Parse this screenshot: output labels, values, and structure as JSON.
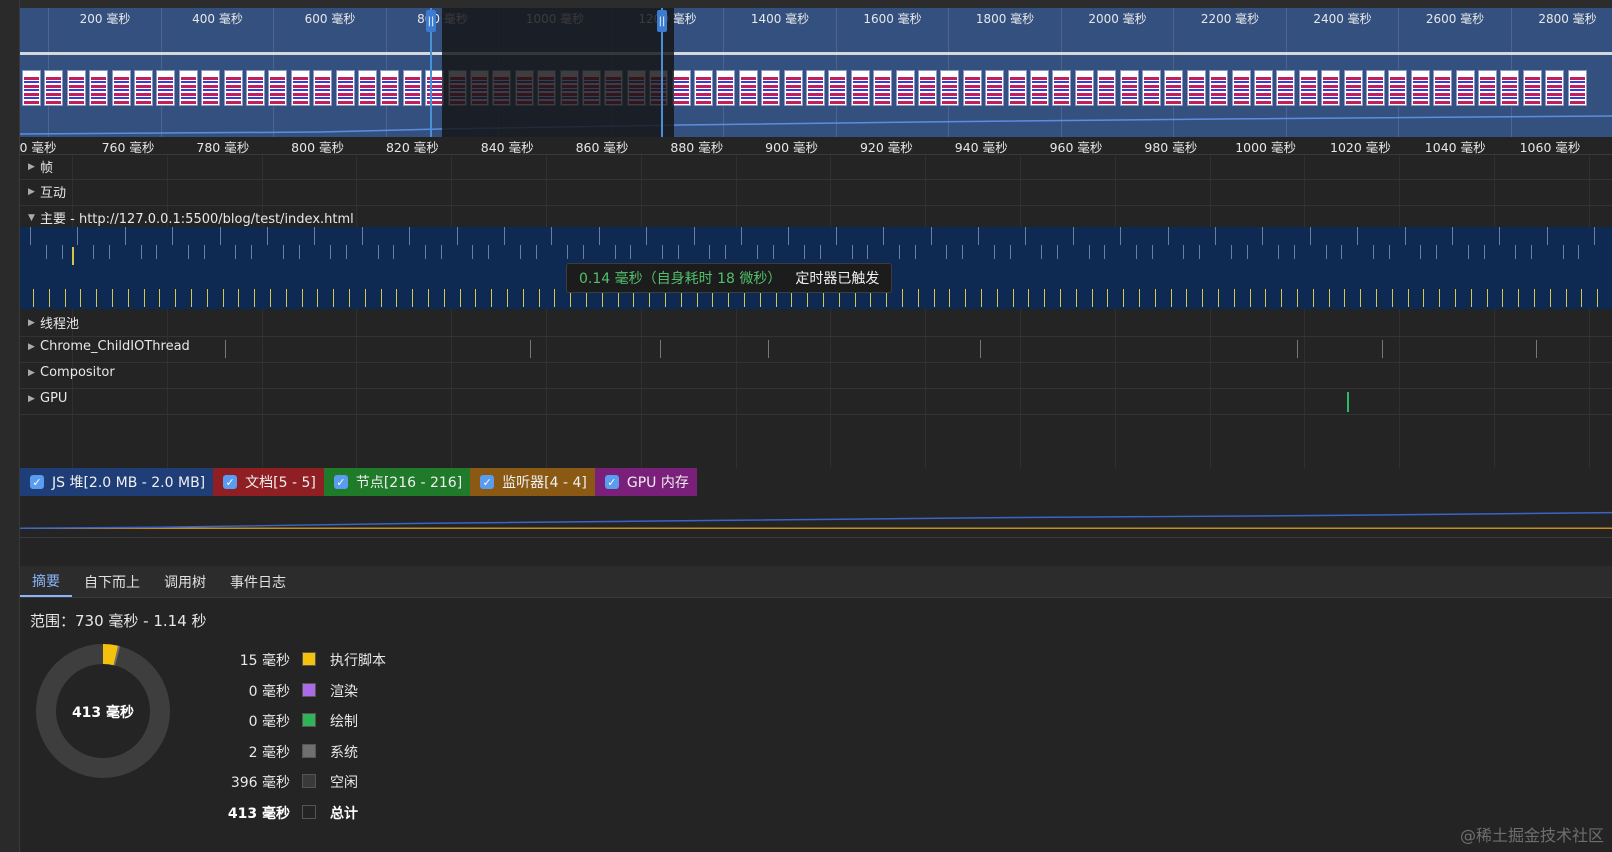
{
  "overview": {
    "ticks": [
      "200 毫秒",
      "400 毫秒",
      "600 毫秒",
      "800 毫秒",
      "1000 毫秒",
      "1200 毫秒",
      "1400 毫秒",
      "1600 毫秒",
      "1800 毫秒",
      "2000 毫秒",
      "2200 毫秒",
      "2400 毫秒",
      "2600 毫秒",
      "2800 毫秒"
    ],
    "grip_left": "||",
    "grip_right": "||"
  },
  "ruler": {
    "ticks": [
      "0 毫秒",
      "760 毫秒",
      "780 毫秒",
      "800 毫秒",
      "820 毫秒",
      "840 毫秒",
      "860 毫秒",
      "880 毫秒",
      "900 毫秒",
      "920 毫秒",
      "940 毫秒",
      "960 毫秒",
      "980 毫秒",
      "1000 毫秒",
      "1020 毫秒",
      "1040 毫秒",
      "1060 毫秒"
    ]
  },
  "tracks": {
    "frames": "帧",
    "interactions": "互动",
    "main": "主要 - http://127.0.0.1:5500/blog/test/index.html",
    "thread_pool": "线程池",
    "child_io": "Chrome_ChildIOThread",
    "compositor": "Compositor",
    "gpu": "GPU"
  },
  "tooltip": {
    "time": "0.14 毫秒（自身耗时 18 微秒）",
    "name": "定时器已触发"
  },
  "counters": [
    {
      "label": "JS 堆[2.0 MB - 2.0 MB]",
      "color": "#1f3e78"
    },
    {
      "label": "文档[5 - 5]",
      "color": "#8f1f22"
    },
    {
      "label": "节点[216 - 216]",
      "color": "#1f7a2a"
    },
    {
      "label": "监听器[4 - 4]",
      "color": "#8a5a15"
    },
    {
      "label": "GPU 内存",
      "color": "#7a1f7a"
    }
  ],
  "tabs": [
    "摘要",
    "自下而上",
    "调用树",
    "事件日志"
  ],
  "summary": {
    "range": "范围：730 毫秒 - 1.14 秒",
    "total_label": "413 毫秒",
    "legend": [
      {
        "value": "15 毫秒",
        "name": "执行脚本",
        "color": "#f4c20d"
      },
      {
        "value": "0 毫秒",
        "name": "渲染",
        "color": "#a96be8"
      },
      {
        "value": "0 毫秒",
        "name": "绘制",
        "color": "#2fb45a"
      },
      {
        "value": "2 毫秒",
        "name": "系统",
        "color": "#6f6f6f"
      },
      {
        "value": "396 毫秒",
        "name": "空闲",
        "color": "#3a3a3a"
      },
      {
        "value": "413 毫秒",
        "name": "总计",
        "color": "#242424"
      }
    ]
  },
  "watermark": "@稀土掘金技术社区"
}
